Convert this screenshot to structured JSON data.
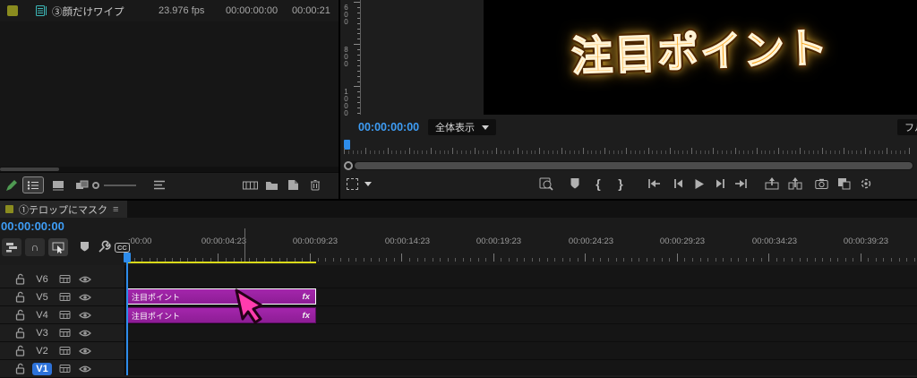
{
  "colors": {
    "accent_blue": "#3e9df5",
    "playhead_blue": "#2d8ceb",
    "clip_purple": "#9821a0",
    "render_bar_yellow": "#d9d919",
    "title_gold": "#f7a41d",
    "cursor_pink": "#ff3cae",
    "track_badge_blue": "#2d72d9",
    "label_chip_olive": "#8a8c1f",
    "sequence_icon_teal": "#3cb8b8"
  },
  "project_panel": {
    "item": {
      "name": "③顔だけワイプ",
      "fps": "23.976 fps",
      "media_start": "00:00:00:00",
      "media_end": "00:00:21"
    }
  },
  "program_monitor": {
    "timecode": "00:00:00:00",
    "zoom_level": "全体表示",
    "quality": "フル画質",
    "title_text": "注目ポイント",
    "vruler_labels": [
      "600",
      "800",
      "1000"
    ],
    "mark_in_glyph": "{",
    "mark_out_glyph": "}"
  },
  "timeline": {
    "tab": "①テロップにマスク",
    "menu_glyph": "≡",
    "timecode": "00:00:00:00",
    "cc": "CC",
    "ruler_labels": [
      ":00:00",
      "00:00:04:23",
      "00:00:09:23",
      "00:00:14:23",
      "00:00:19:23",
      "00:00:24:23",
      "00:00:29:23",
      "00:00:34:23",
      "00:00:39:23"
    ],
    "tracks": [
      {
        "label": "V6"
      },
      {
        "label": "V5"
      },
      {
        "label": "V4"
      },
      {
        "label": "V3"
      },
      {
        "label": "V2"
      },
      {
        "label": "V1"
      }
    ],
    "clips": [
      {
        "label": "注目ポイント",
        "fx": "fx"
      },
      {
        "label": "注目ポイント",
        "fx": "fx"
      }
    ]
  },
  "icons": {
    "sequence": "teal filmstrip",
    "pencil": "green edit pencil",
    "list_view": "list rows",
    "icon_view": "thumbnail",
    "freeform_view": "stacked cards",
    "zoom_slider": "dot and line",
    "sort": "stacked lines",
    "automate_to_sequence": "filmstrip",
    "new_bin": "folder",
    "new_item": "page",
    "delete": "trash can",
    "safe_margins": "dashed square",
    "comparison_view": "magnifier over frame",
    "add_marker": "flag",
    "go_to_in": "bar with left arrow",
    "step_back": "bar with left triangle",
    "play": "triangle",
    "step_forward": "bar with right triangle",
    "go_to_out": "bar with right arrow",
    "lift": "frame with up arrow",
    "extract": "frame with up arrow segmented",
    "export_frame": "camera",
    "compare": "overlapping squares",
    "settings_gear": "gear",
    "nest_toggle": "stacked clips",
    "snap": "magnet",
    "linked_selection": "pointer",
    "timeline_settings": "wrench",
    "track_lock": "open padlock",
    "track_sync_lock": "film block",
    "track_output": "eye"
  }
}
